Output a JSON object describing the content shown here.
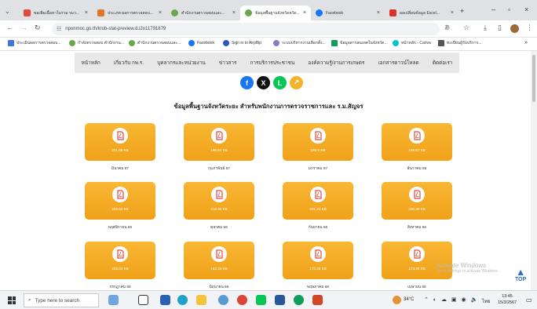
{
  "browser": {
    "tabs": [
      {
        "title": "ขอเพิ่มเนื้อหาในร่วม รมว..."
      },
      {
        "title": "ประเภท ผลการตรวจสอบ..."
      },
      {
        "title": "ตำนักงานตรวจสอบและ..."
      },
      {
        "title": "ข้อมูลพื้นฐานจังหวัดหวัด..."
      },
      {
        "title": "Facebook"
      },
      {
        "title": "ผลเปลี่ยนข้อมูล Excel..."
      }
    ],
    "new_tab": "+",
    "url": "nponmoc.go.th/krob-stat-preview.d.i2n11791879",
    "bookmarks": [
      "ประเมินผลการตรวจสอบ...",
      "กำลังตรวจสอบ ตำนักงาน...",
      "ตำนักงานตรวจสอบและ...",
      "Facebook",
      "Sign in to AirpBip",
      "ระบบบริหารงานเลือกตั้ง...",
      "ข้อมูลสารสนเทศในจังหวัด...",
      "หน้าหลัก - Canva",
      "ทะเบียนผู้รับบริการ..."
    ]
  },
  "site": {
    "nav": [
      "หน้าหลัก",
      "เกี่ยวกับ กพ.ร.",
      "บุคลากรและหน่วยงาน",
      "ข่าวสาร",
      "การบริการประชาชน",
      "องค์ความรู้/งานการเกษตร",
      "เอกสารดาวน์โหลด",
      "ติดต่อเรา"
    ],
    "social": [
      {
        "name": "facebook",
        "color": "#1877f2",
        "glyph": "f"
      },
      {
        "name": "x",
        "color": "#111111",
        "glyph": "X"
      },
      {
        "name": "line",
        "color": "#06c755",
        "glyph": "L"
      },
      {
        "name": "share",
        "color": "#f3b32a",
        "glyph": "↗"
      }
    ],
    "heading": "ข้อมูลพื้นฐานจังหวัดระยะ สำหรับพนักงานการตรวจราชการและ ร.ม.สัญจร",
    "files": [
      {
        "size": "321.05 KB",
        "label": "มีนาคม 67"
      },
      {
        "size": "195.51 KB",
        "label": "กุมภาพันธ์ 67"
      },
      {
        "size": "183.6 KB",
        "label": "มกราคม 67"
      },
      {
        "size": "168.67 KB",
        "label": "ธันวาคม 66"
      },
      {
        "size": "203.02 KB",
        "label": "พฤศจิกายน 66"
      },
      {
        "size": "212.30 KB",
        "label": "ตุลาคม 66"
      },
      {
        "size": "201.21 KB",
        "label": "กันยายน 66"
      },
      {
        "size": "200.30 KB",
        "label": "สิงหาคม 66"
      },
      {
        "size": "203.04 KB",
        "label": "กรกฎาคม 66"
      },
      {
        "size": "162.34 KB",
        "label": "มิถุนายน 66"
      },
      {
        "size": "173.45 KB",
        "label": "พฤษภาคม 66"
      },
      {
        "size": "173.93 KB",
        "label": "เมษายน 66"
      }
    ],
    "watermark_title": "Activate Windows",
    "watermark_sub": "Go to Settings to activate Windows.",
    "top_button": "TOP"
  },
  "taskbar": {
    "search_placeholder": "Type here to search",
    "weather": "34°C",
    "language": "ไทย",
    "time": "13:45",
    "date": "15/3/2567"
  }
}
